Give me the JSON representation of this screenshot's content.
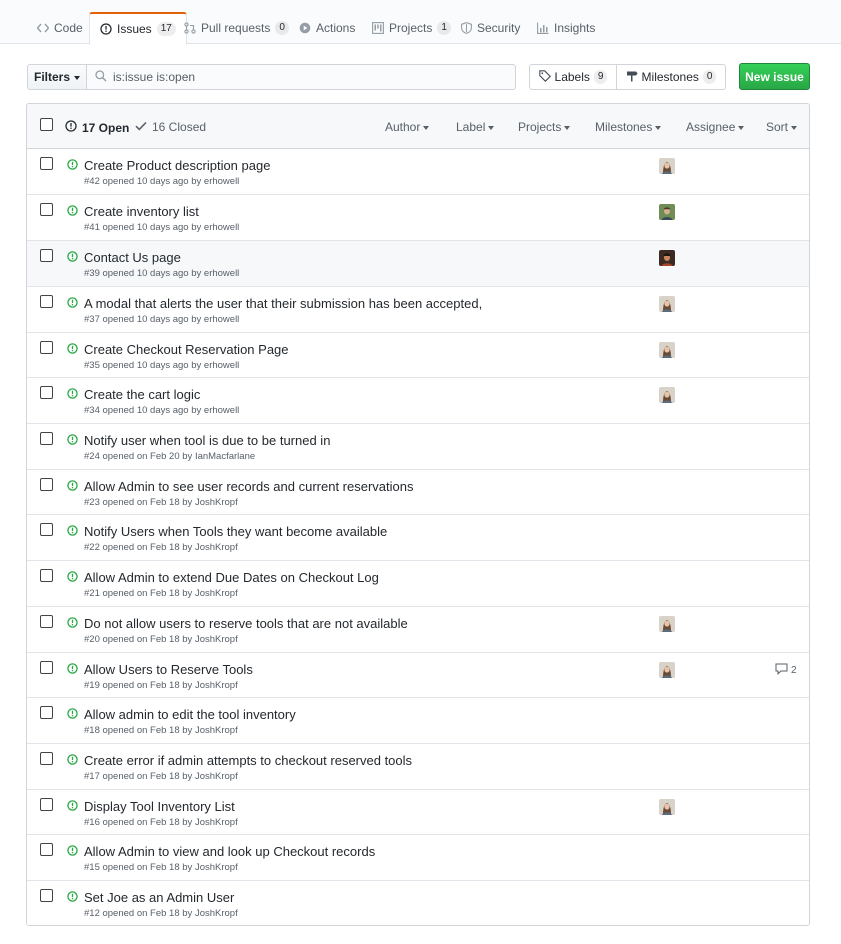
{
  "nav": {
    "tabs": [
      {
        "label": "Code",
        "count": "",
        "icon": "code-icon"
      },
      {
        "label": "Issues",
        "count": "17",
        "icon": "issue-opened-icon"
      },
      {
        "label": "Pull requests",
        "count": "0",
        "icon": "git-pull-request-icon"
      },
      {
        "label": "Actions",
        "count": "",
        "icon": "play-icon"
      },
      {
        "label": "Projects",
        "count": "1",
        "icon": "project-icon"
      },
      {
        "label": "Security",
        "count": "",
        "icon": "shield-icon"
      },
      {
        "label": "Insights",
        "count": "",
        "icon": "graph-icon"
      }
    ]
  },
  "subnav": {
    "filters_label": "Filters",
    "search_value": "is:issue is:open",
    "labels_label": "Labels",
    "labels_count": "9",
    "milestones_label": "Milestones",
    "milestones_count": "0",
    "new_issue_label": "New issue"
  },
  "header": {
    "open_label": "17 Open",
    "closed_label": "16 Closed",
    "filters": [
      "Author",
      "Label",
      "Projects",
      "Milestones",
      "Assignee",
      "Sort"
    ]
  },
  "colors": {
    "open_green": "#28a745",
    "accent_orange": "#e36209",
    "primary_button": "#2ea44f"
  },
  "issues": [
    {
      "title": "Create Product description page",
      "meta": "#42 opened 10 days ago by ",
      "author": "erhowell",
      "avatar": "woman-avatar",
      "comments": ""
    },
    {
      "title": "Create inventory list",
      "meta": "#41 opened 10 days ago by ",
      "author": "erhowell",
      "avatar": "man-avatar-green",
      "comments": ""
    },
    {
      "title": "Contact Us page",
      "meta": "#39 opened 10 days ago by ",
      "author": "erhowell",
      "avatar": "man-avatar-dark",
      "comments": ""
    },
    {
      "title": "A modal that alerts the user that their submission has been accepted,",
      "meta": "#37 opened 10 days ago by ",
      "author": "erhowell",
      "avatar": "woman-avatar",
      "comments": ""
    },
    {
      "title": "Create Checkout Reservation Page",
      "meta": "#35 opened 10 days ago by ",
      "author": "erhowell",
      "avatar": "woman-avatar",
      "comments": ""
    },
    {
      "title": "Create the cart logic",
      "meta": "#34 opened 10 days ago by ",
      "author": "erhowell",
      "avatar": "woman-avatar",
      "comments": ""
    },
    {
      "title": "Notify user when tool is due to be turned in",
      "meta": "#24 opened on Feb 20 by ",
      "author": "IanMacfarlane",
      "avatar": "",
      "comments": ""
    },
    {
      "title": "Allow Admin to see user records and current reservations",
      "meta": "#23 opened on Feb 18 by ",
      "author": "JoshKropf",
      "avatar": "",
      "comments": ""
    },
    {
      "title": "Notify Users when Tools they want become available",
      "meta": "#22 opened on Feb 18 by ",
      "author": "JoshKropf",
      "avatar": "",
      "comments": ""
    },
    {
      "title": "Allow Admin to extend Due Dates on Checkout Log",
      "meta": "#21 opened on Feb 18 by ",
      "author": "JoshKropf",
      "avatar": "",
      "comments": ""
    },
    {
      "title": "Do not allow users to reserve tools that are not available",
      "meta": "#20 opened on Feb 18 by ",
      "author": "JoshKropf",
      "avatar": "woman-avatar",
      "comments": ""
    },
    {
      "title": "Allow Users to Reserve Tools",
      "meta": "#19 opened on Feb 18 by ",
      "author": "JoshKropf",
      "avatar": "woman-avatar",
      "comments": "2"
    },
    {
      "title": "Allow admin to edit the tool inventory",
      "meta": "#18 opened on Feb 18 by ",
      "author": "JoshKropf",
      "avatar": "",
      "comments": ""
    },
    {
      "title": "Create error if admin attempts to checkout reserved tools",
      "meta": "#17 opened on Feb 18 by ",
      "author": "JoshKropf",
      "avatar": "",
      "comments": ""
    },
    {
      "title": "Display Tool Inventory List",
      "meta": "#16 opened on Feb 18 by ",
      "author": "JoshKropf",
      "avatar": "woman-avatar",
      "comments": ""
    },
    {
      "title": "Allow Admin to view and look up Checkout records",
      "meta": "#15 opened on Feb 18 by ",
      "author": "JoshKropf",
      "avatar": "",
      "comments": ""
    },
    {
      "title": "Set Joe as an Admin User",
      "meta": "#12 opened on Feb 18 by ",
      "author": "JoshKropf",
      "avatar": "",
      "comments": ""
    }
  ]
}
